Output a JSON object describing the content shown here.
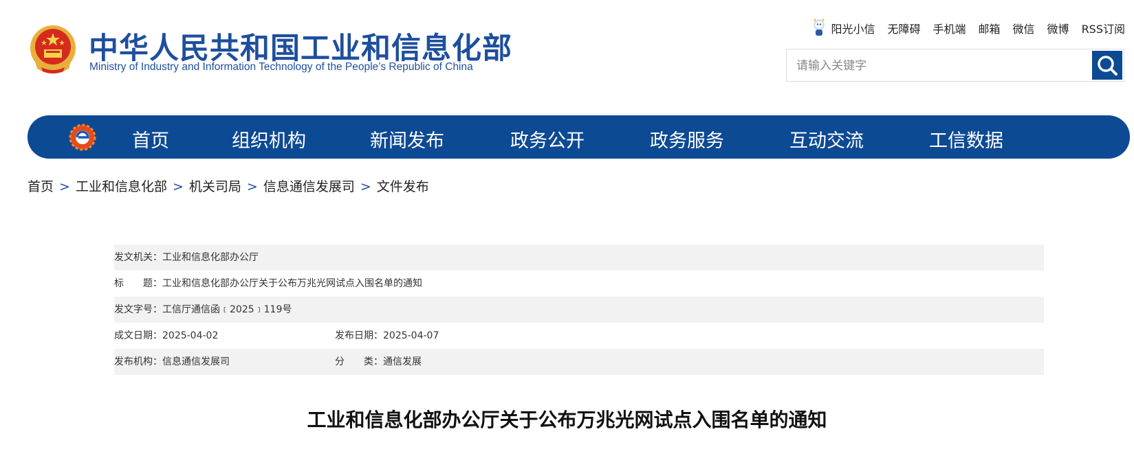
{
  "header": {
    "logo_cn": "中华人民共和国工业和信息化部",
    "logo_en": "Ministry of Industry and Information Technology of the People’s Republic of China",
    "top_links": [
      "阳光小信",
      "无障碍",
      "手机端",
      "邮箱",
      "微信",
      "微博",
      "RSS订阅"
    ],
    "search_placeholder": "请输入关键字"
  },
  "nav": {
    "items": [
      "首页",
      "组织机构",
      "新闻发布",
      "政务公开",
      "政务服务",
      "互动交流",
      "工信数据"
    ]
  },
  "breadcrumb": [
    "首页",
    "工业和信息化部",
    "机关司局",
    "信息通信发展司",
    "文件发布"
  ],
  "meta": {
    "issuer_label": "发文机关：",
    "issuer": "工业和信息化部办公厅",
    "title_label": "标　　题：",
    "title": "工业和信息化部办公厅关于公布万兆光网试点入围名单的通知",
    "doc_no_label": "发文字号：",
    "doc_no": "工信厅通信函﹝2025﹞119号",
    "written_date_label": "成文日期：",
    "written_date": "2025-04-02",
    "publish_date_label": "发布日期：",
    "publish_date": "2025-04-07",
    "publisher_label": "发布机构：",
    "publisher": "信息通信发展司",
    "category_label": "分　　类：",
    "category": "通信发展"
  },
  "document": {
    "title": "工业和信息化部办公厅关于公布万兆光网试点入围名单的通知"
  },
  "colors": {
    "brand_blue": "#0d4a94",
    "logo_blue": "#1e4f9e",
    "shade": "#f2f2f2"
  }
}
